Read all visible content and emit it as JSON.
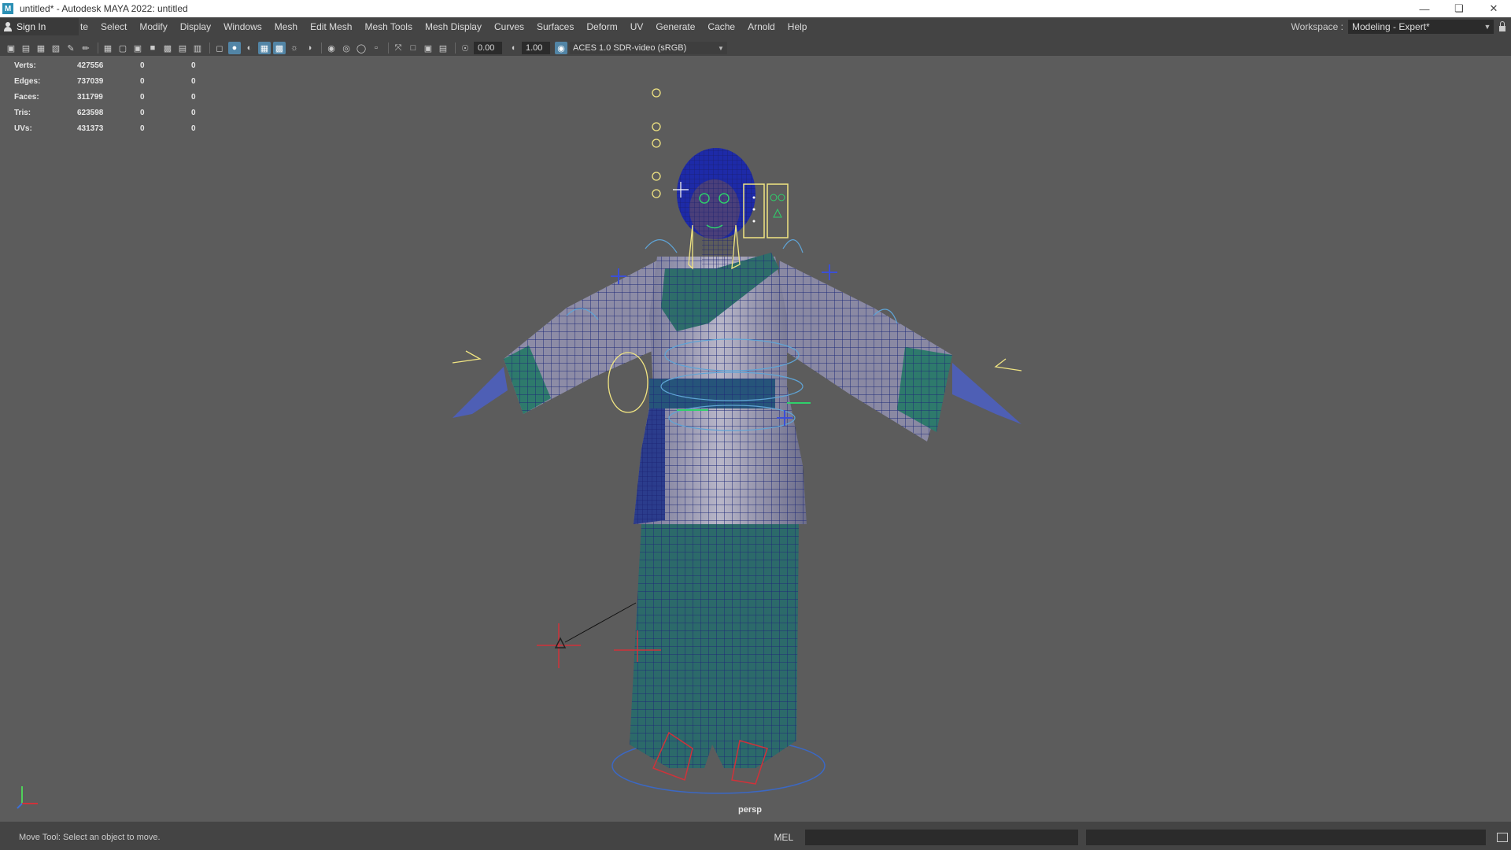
{
  "window": {
    "title": "untitled* - Autodesk MAYA 2022: untitled",
    "app_icon": "M",
    "controls": [
      "minimize-icon",
      "restore-icon",
      "close-icon"
    ]
  },
  "menubar": {
    "signin_label": "Sign In",
    "items": [
      "te",
      "Select",
      "Modify",
      "Display",
      "Windows",
      "Mesh",
      "Edit Mesh",
      "Mesh Tools",
      "Mesh Display",
      "Curves",
      "Surfaces",
      "Deform",
      "UV",
      "Generate",
      "Cache",
      "Arnold",
      "Help"
    ],
    "workspace_label": "Workspace :",
    "workspace_value": "Modeling - Expert*"
  },
  "toolbar": {
    "exposure_value": "0.00",
    "gamma_value": "1.00",
    "color_space": "ACES 1.0 SDR-video (sRGB)"
  },
  "hud": {
    "rows": [
      {
        "label": "Verts:",
        "v1": "427556",
        "v2": "0",
        "v3": "0"
      },
      {
        "label": "Edges:",
        "v1": "737039",
        "v2": "0",
        "v3": "0"
      },
      {
        "label": "Faces:",
        "v1": "311799",
        "v2": "0",
        "v3": "0"
      },
      {
        "label": "Tris:",
        "v1": "623598",
        "v2": "0",
        "v3": "0"
      },
      {
        "label": "UVs:",
        "v1": "431373",
        "v2": "0",
        "v3": "0"
      }
    ]
  },
  "viewport": {
    "camera_label": "persp"
  },
  "statusbar": {
    "message": "Move Tool: Select an object to move.",
    "mel_label": "MEL"
  }
}
